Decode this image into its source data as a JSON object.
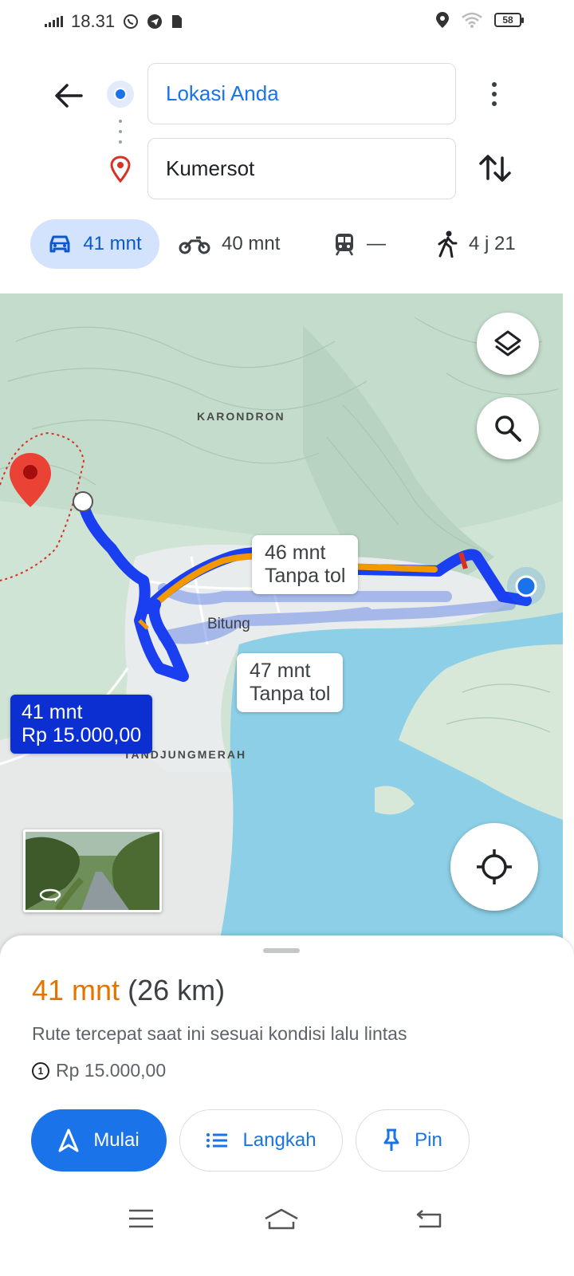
{
  "status_bar": {
    "time": "18.31",
    "battery": "58",
    "icons_left": [
      "signal-icon",
      "whatsapp-icon",
      "telegram-icon",
      "sim-icon"
    ],
    "icons_right": [
      "location-icon",
      "wifi-icon",
      "battery-icon"
    ]
  },
  "directions": {
    "origin": "Lokasi Anda",
    "destination": "Kumersot"
  },
  "modes": [
    {
      "name": "car",
      "label": "41 mnt",
      "active": true
    },
    {
      "name": "motorcycle",
      "label": "40 mnt",
      "active": false
    },
    {
      "name": "transit",
      "label": "—",
      "active": false
    },
    {
      "name": "walk",
      "label": "4 j 21",
      "active": false
    }
  ],
  "map": {
    "area_labels": {
      "karondron": "KARONDRON",
      "tanjungmerah": "TANDJUNGMERAH",
      "bitung": "Bitung"
    },
    "route_bubbles": {
      "alt1": {
        "time": "46 mnt",
        "note": "Tanpa tol"
      },
      "alt2": {
        "time": "47 mnt",
        "note": "Tanpa tol"
      },
      "selected": {
        "time": "41 mnt",
        "price": "Rp 15.000,00"
      }
    },
    "colors": {
      "route_selected": "#1a3ff0",
      "route_alt": "#a8c7fa",
      "traffic_slow": "#f29900",
      "traffic_jam": "#d93025",
      "water": "#8ccfe6",
      "land": "#cfe4d4"
    }
  },
  "sheet": {
    "time": "41 mnt",
    "distance": "(26 km)",
    "description": "Rute tercepat saat ini sesuai kondisi lalu lintas",
    "toll": "Rp 15.000,00",
    "buttons": {
      "start": "Mulai",
      "steps": "Langkah",
      "pin": "Pin"
    }
  }
}
